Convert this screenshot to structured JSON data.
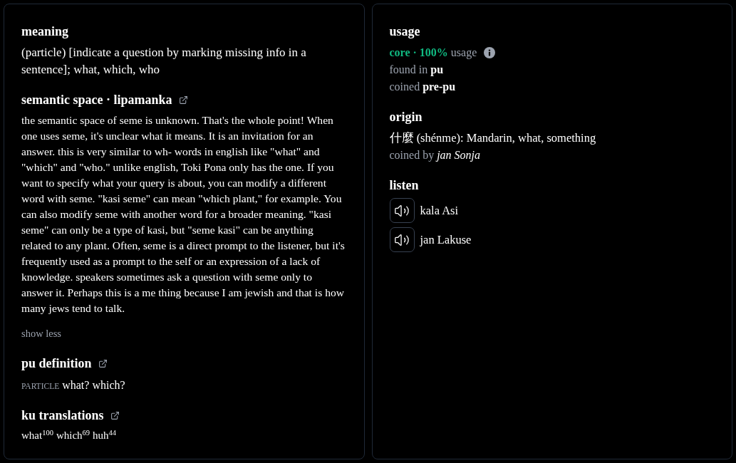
{
  "definition_panel": {
    "meaning": {
      "heading": "meaning",
      "text": "(particle) [indicate a question by marking missing info in a sentence]; what, which, who"
    },
    "semantic_space": {
      "heading": "semantic space · lipamanka",
      "text": "the semantic space of seme is unknown. That's the whole point! When one uses seme, it's unclear what it means. It is an invitation for an answer. this is very similar to wh- words in english like \"what\" and \"which\" and \"who.\" unlike english, Toki Pona only has the one. If you want to specify what your query is about, you can modify a different word with seme. \"kasi seme\" can mean \"which plant,\" for example. You can also modify seme with another word for a broader meaning. \"kasi seme\" can only be a type of kasi, but \"seme kasi\" can be anything related to any plant. Often, seme is a direct prompt to the listener, but it's frequently used as a prompt to the self or an expression of a lack of knowledge. speakers sometimes ask a question with seme only to answer it. Perhaps this is a me thing because I am jewish and that is how many jews tend to talk.",
      "toggle": "show less"
    },
    "pu_definition": {
      "heading": "pu definition",
      "part_of_speech": "PARTICLE",
      "text": "what? which?"
    },
    "ku_translations": {
      "heading": "ku translations",
      "items": [
        {
          "word": "what",
          "count": "100"
        },
        {
          "word": "which",
          "count": "69"
        },
        {
          "word": "huh",
          "count": "44"
        }
      ]
    }
  },
  "info_panel": {
    "usage": {
      "heading": "usage",
      "category": "core · 100%",
      "category_suffix": "usage",
      "found_in": "found in **pu**",
      "coined": "coined **pre-pu**"
    },
    "origin": {
      "heading": "origin",
      "text": "什麼 (shénme): Mandarin, what, something",
      "coined_by": "coined by *jan Sonja*"
    },
    "listen": {
      "heading": "listen",
      "recordings": [
        {
          "speaker": "kala Asi"
        },
        {
          "speaker": "jan Lakuse"
        }
      ]
    }
  }
}
